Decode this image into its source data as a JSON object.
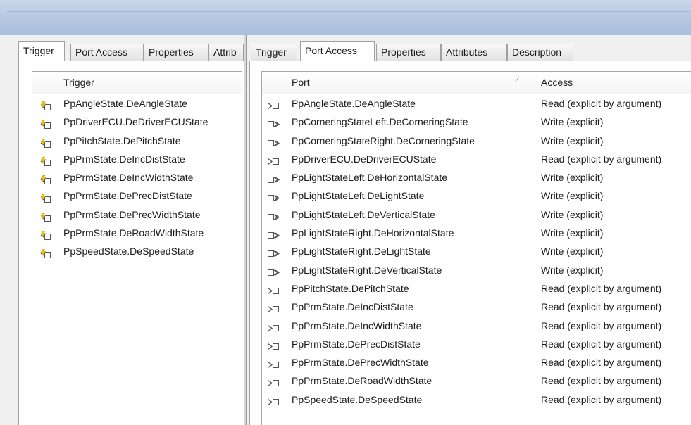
{
  "left_panel": {
    "tabs": [
      "Trigger",
      "Port Access",
      "Properties",
      "Attrib"
    ],
    "header": "Trigger",
    "rows": [
      "PpAngleState.DeAngleState",
      "PpDriverECU.DeDriverECUState",
      "PpPitchState.DePitchState",
      "PpPrmState.DeIncDistState",
      "PpPrmState.DeIncWidthState",
      "PpPrmState.DePrecDistState",
      "PpPrmState.DePrecWidthState",
      "PpPrmState.DeRoadWidthState",
      "PpSpeedState.DeSpeedState"
    ]
  },
  "right_panel": {
    "tabs": [
      "Trigger",
      "Port Access",
      "Properties",
      "Attributes",
      "Description"
    ],
    "headers": {
      "port": "Port",
      "access": "Access"
    },
    "rows": [
      {
        "icon": "receiver-port-icon",
        "port": "PpAngleState.DeAngleState",
        "access": "Read (explicit by argument)"
      },
      {
        "icon": "sender-port-icon",
        "port": "PpCorneringStateLeft.DeCorneringState",
        "access": "Write (explicit)"
      },
      {
        "icon": "sender-port-icon",
        "port": "PpCorneringStateRight.DeCorneringState",
        "access": "Write (explicit)"
      },
      {
        "icon": "receiver-port-icon",
        "port": "PpDriverECU.DeDriverECUState",
        "access": "Read (explicit by argument)"
      },
      {
        "icon": "sender-port-icon",
        "port": "PpLightStateLeft.DeHorizontalState",
        "access": "Write (explicit)"
      },
      {
        "icon": "sender-port-icon",
        "port": "PpLightStateLeft.DeLightState",
        "access": "Write (explicit)"
      },
      {
        "icon": "sender-port-icon",
        "port": "PpLightStateLeft.DeVerticalState",
        "access": "Write (explicit)"
      },
      {
        "icon": "sender-port-icon",
        "port": "PpLightStateRight.DeHorizontalState",
        "access": "Write (explicit)"
      },
      {
        "icon": "sender-port-icon",
        "port": "PpLightStateRight.DeLightState",
        "access": "Write (explicit)"
      },
      {
        "icon": "sender-port-icon",
        "port": "PpLightStateRight.DeVerticalState",
        "access": "Write (explicit)"
      },
      {
        "icon": "receiver-port-icon",
        "port": "PpPitchState.DePitchState",
        "access": "Read (explicit by argument)"
      },
      {
        "icon": "receiver-port-icon",
        "port": "PpPrmState.DeIncDistState",
        "access": "Read (explicit by argument)"
      },
      {
        "icon": "receiver-port-icon",
        "port": "PpPrmState.DeIncWidthState",
        "access": "Read (explicit by argument)"
      },
      {
        "icon": "receiver-port-icon",
        "port": "PpPrmState.DePrecDistState",
        "access": "Read (explicit by argument)"
      },
      {
        "icon": "receiver-port-icon",
        "port": "PpPrmState.DePrecWidthState",
        "access": "Read (explicit by argument)"
      },
      {
        "icon": "receiver-port-icon",
        "port": "PpPrmState.DeRoadWidthState",
        "access": "Read (explicit by argument)"
      },
      {
        "icon": "receiver-port-icon",
        "port": "PpSpeedState.DeSpeedState",
        "access": "Read (explicit by argument)"
      }
    ]
  },
  "colors": {
    "header_band": "#b5c8e2",
    "tab_border": "#a0a0a0",
    "icon_gray": "#555555",
    "bolt_yellow": "#f2c200"
  }
}
